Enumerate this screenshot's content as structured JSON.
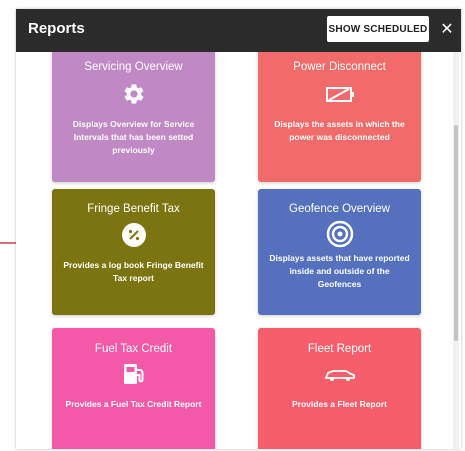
{
  "dialog": {
    "title": "Reports",
    "show_scheduled_label": "SHOW SCHEDULED",
    "close_glyph": "✕"
  },
  "cards": [
    {
      "title": "Servicing Overview",
      "icon": "gear-icon",
      "description": "Displays Overview for Service Intervals that has been setted previously",
      "color": "#c088c4"
    },
    {
      "title": "Power Disconnect",
      "icon": "battery-disconnect-icon",
      "description": "Displays the assets in which the power was disconnected",
      "color": "#f26b6b"
    },
    {
      "title": "Fringe Benefit Tax",
      "icon": "percent-icon",
      "description": "Provides a log book Fringe Benefit Tax report",
      "color": "#7c7410"
    },
    {
      "title": "Geofence Overview",
      "icon": "geofence-icon",
      "description": "Displays assets that have reported inside and outside of the Geofences",
      "color": "#5571bd"
    },
    {
      "title": "Fuel Tax Credit",
      "icon": "fuel-pump-icon",
      "description": "Provides a Fuel Tax Credit Report",
      "color": "#f25aa7"
    },
    {
      "title": "Fleet Report",
      "icon": "car-icon",
      "description": "Provides a Fleet Report",
      "color": "#f55e6a"
    }
  ],
  "annotation": {
    "arrow_color": "#b71c2b"
  }
}
